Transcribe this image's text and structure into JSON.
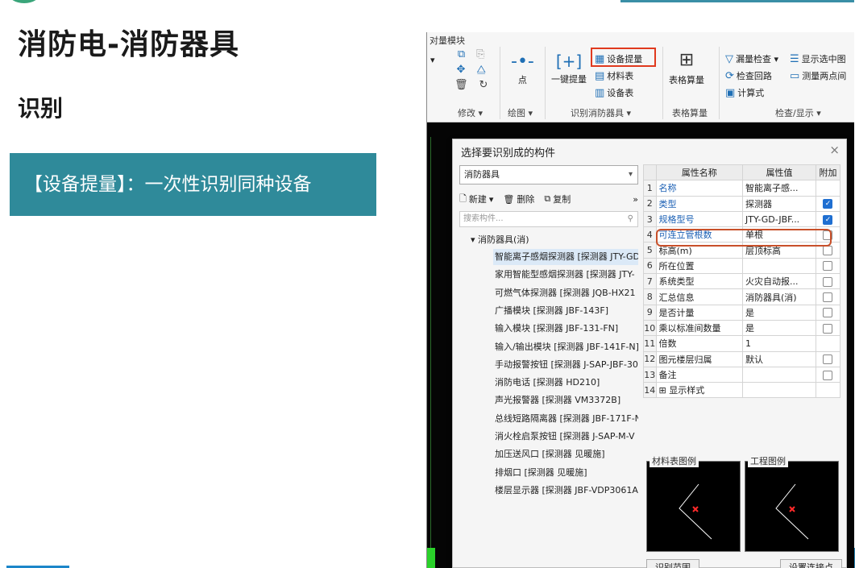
{
  "slide": {
    "title": "消防电-消防器具",
    "subtitle": "识别",
    "banner": "【设备提量】：一次性识别同种设备"
  },
  "ribbon": {
    "tab": "对量模块",
    "modify_group": "修改 ▾",
    "draw_group": "绘图 ▾",
    "point": "点",
    "one_key": "一键提量",
    "equip_extract": "设备提量",
    "material_table": "材料表",
    "equip_table": "设备表",
    "identify_group": "识别消防器具 ▾",
    "table_calc": "表格算量",
    "table_calc_group": "表格算量",
    "missing_check": "漏量检查 ▾",
    "show_selected": "显示选中图",
    "check_loop": "检查回路",
    "measure_two": "测量两点间",
    "formula": "计算式",
    "check_group": "检查/显示 ▾"
  },
  "dialog": {
    "title": "选择要识别成的构件",
    "close": "×",
    "dropdown_value": "消防器具",
    "new": "新建",
    "delete": "删除",
    "copy": "复制",
    "more": "»",
    "search_placeholder": "搜索构件...",
    "tree_root": "▾ 消防器具(消)",
    "tree_items": [
      "智能离子感烟探测器 [探测器 JTY-GD-JBF]",
      "家用智能型感烟探测器 [探测器 JTY-",
      "可燃气体探测器 [探测器 JQB-HX21",
      "广播模块 [探测器 JBF-143F]",
      "输入模块 [探测器 JBF-131-FN]",
      "输入/输出模块 [探测器 JBF-141F-N]",
      "手动报警按钮 [探测器 J-SAP-JBF-30",
      "消防电话 [探测器 HD210]",
      "声光报警器 [探测器 VM3372B]",
      "总线短路隔离器 [探测器 JBF-171F-N",
      "消火栓启泵按钮 [探测器 J-SAP-M-V",
      "加压送风口 [探测器 见暖施]",
      "排烟口 [探测器 见暖施]",
      "楼层显示器 [探测器 JBF-VDP3061A]"
    ],
    "table_headers": {
      "name": "属性名称",
      "value": "属性值",
      "extra": "附加"
    },
    "rows": [
      {
        "idx": "1",
        "name": "名称",
        "value": "智能离子感...",
        "link": true,
        "checkbox": "none"
      },
      {
        "idx": "2",
        "name": "类型",
        "value": "探测器",
        "link": true,
        "checkbox": "on"
      },
      {
        "idx": "3",
        "name": "规格型号",
        "value": "JTY-GD-JBF...",
        "link": true,
        "checkbox": "on"
      },
      {
        "idx": "4",
        "name": "可连立管根数",
        "value": "单根",
        "link": true,
        "checkbox": "off"
      },
      {
        "idx": "5",
        "name": "标高(m)",
        "value": "层顶标高",
        "link": false,
        "checkbox": "off"
      },
      {
        "idx": "6",
        "name": "所在位置",
        "value": "",
        "link": false,
        "checkbox": "off"
      },
      {
        "idx": "7",
        "name": "系统类型",
        "value": "火灾自动报...",
        "link": false,
        "checkbox": "off"
      },
      {
        "idx": "8",
        "name": "汇总信息",
        "value": "消防器具(消)",
        "link": false,
        "checkbox": "off"
      },
      {
        "idx": "9",
        "name": "是否计量",
        "value": "是",
        "link": false,
        "checkbox": "off"
      },
      {
        "idx": "10",
        "name": "乘以标准间数量",
        "value": "是",
        "link": false,
        "checkbox": "off"
      },
      {
        "idx": "11",
        "name": "倍数",
        "value": "1",
        "link": false,
        "checkbox": "none"
      },
      {
        "idx": "12",
        "name": "图元楼层归属",
        "value": "默认",
        "link": false,
        "checkbox": "off"
      },
      {
        "idx": "13",
        "name": "备注",
        "value": "",
        "link": false,
        "checkbox": "off"
      },
      {
        "idx": "14",
        "name": "⊞ 显示样式",
        "value": "",
        "link": false,
        "checkbox": "none"
      }
    ],
    "legend_material": "材料表图例",
    "legend_project": "工程图例",
    "btn_identify_range": "识别范围",
    "btn_set_connect": "设置连接点"
  }
}
